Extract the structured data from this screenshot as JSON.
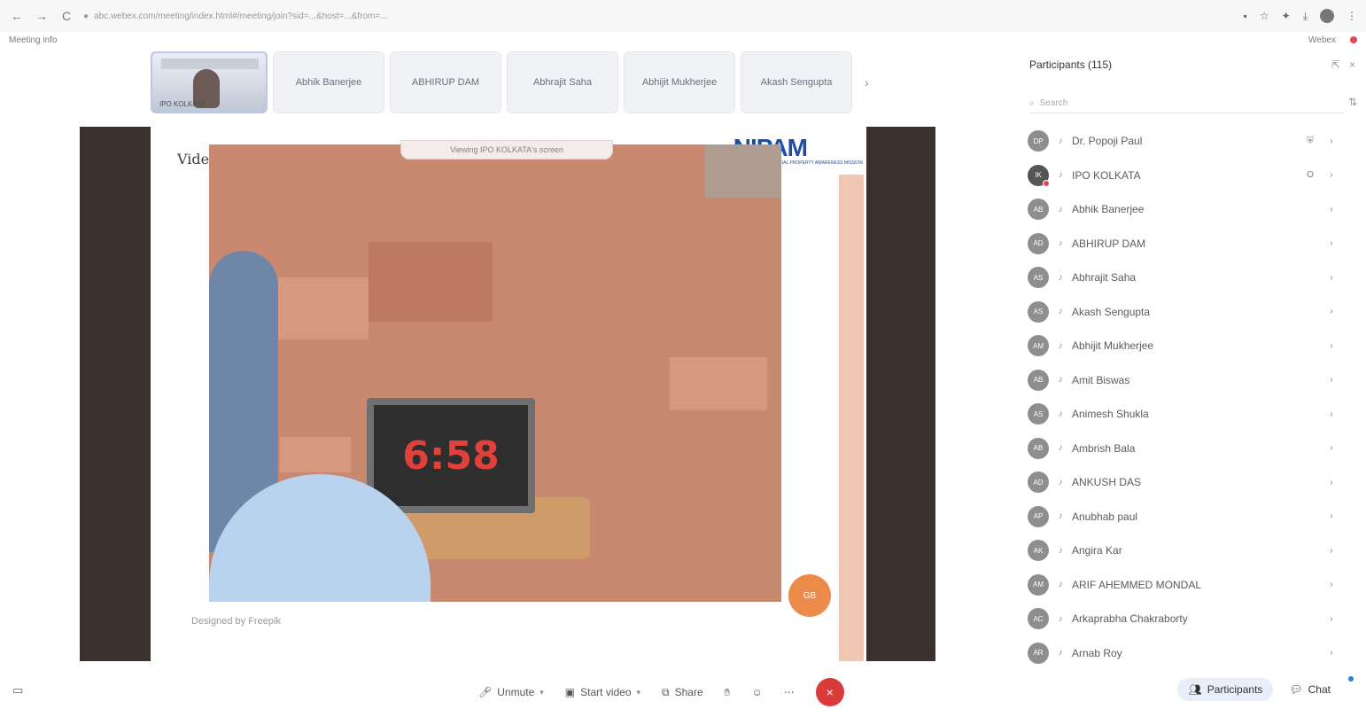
{
  "browser": {
    "url_text": "abc.webex.com/meeting/index.html#/meeting/join?sid=...&host=...&from=...",
    "back_icon": "←",
    "forward_icon": "→",
    "reload_icon": "C"
  },
  "meta": {
    "meeting_info": "Meeting info",
    "right_label": "Webex"
  },
  "filmstrip": {
    "self_caption": "IPO KOLKATA",
    "tiles": [
      "Abhik Banerjee",
      "ABHIRUP DAM",
      "Abhrajit Saha",
      "Abhijit Mukherjee",
      "Akash Sengupta"
    ],
    "next_icon": "›"
  },
  "share": {
    "viewing_label": "Viewing IPO KOLKATA's screen",
    "brand_left": "Vide.o",
    "nipam": "NIPAM",
    "nipam_tag": "NATIONAL INTELLECTUAL PROPERTY AWARENESS MISSION",
    "clock_time": "6:58",
    "footer": "Designed by Freepik",
    "orange_btn": "GB"
  },
  "participants": {
    "title": "Participants (115)",
    "search_placeholder": "Search",
    "list": [
      {
        "initials": "DP",
        "name": "Dr. Popoji Paul",
        "extra": "⛨"
      },
      {
        "initials": "IK",
        "name": "IPO KOLKATA",
        "extra": "O",
        "special": true
      },
      {
        "initials": "AB",
        "name": "Abhik Banerjee",
        "extra": ""
      },
      {
        "initials": "AD",
        "name": "ABHIRUP DAM",
        "extra": ""
      },
      {
        "initials": "AS",
        "name": "Abhrajit Saha",
        "extra": ""
      },
      {
        "initials": "AS",
        "name": "Akash Sengupta",
        "extra": ""
      },
      {
        "initials": "AM",
        "name": "Abhijit Mukherjee",
        "extra": ""
      },
      {
        "initials": "AB",
        "name": "Amit Biswas",
        "extra": ""
      },
      {
        "initials": "AS",
        "name": "Animesh Shukla",
        "extra": ""
      },
      {
        "initials": "AB",
        "name": "Ambrish Bala",
        "extra": ""
      },
      {
        "initials": "AD",
        "name": "ANKUSH DAS",
        "extra": ""
      },
      {
        "initials": "AP",
        "name": "Anubhab paul",
        "extra": ""
      },
      {
        "initials": "AK",
        "name": "Angira Kar",
        "extra": ""
      },
      {
        "initials": "AM",
        "name": "ARIF AHEMMED MONDAL",
        "extra": ""
      },
      {
        "initials": "AC",
        "name": "Arkaprabha Chakraborty",
        "extra": ""
      },
      {
        "initials": "AR",
        "name": "Arnab Roy",
        "extra": ""
      }
    ]
  },
  "toolbar": {
    "unmute": "Unmute",
    "start_video": "Start video",
    "share": "Share",
    "participants": "Participants",
    "chat": "Chat"
  }
}
